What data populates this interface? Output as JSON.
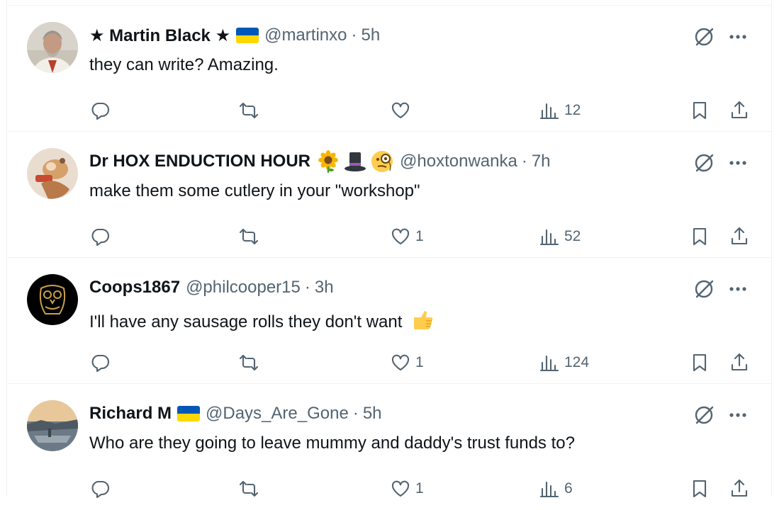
{
  "tweets": [
    {
      "name": "★ Martin Black ★",
      "badges": [
        "ua-flag"
      ],
      "handle": "@martinxo",
      "time": "5h",
      "text": "they can write? Amazing.",
      "counts": {
        "reply": "",
        "retweet": "",
        "like": "",
        "views": "12"
      },
      "avatar": "avatar-man-photo"
    },
    {
      "name": "Dr HOX ENDUCTION HOUR",
      "badges": [
        "sunflower-emoji",
        "top-hat-emoji",
        "monocle-face-emoji"
      ],
      "handle": "@hoxtonwanka",
      "time": "7h",
      "text": "make them some cutlery in your \"workshop\"",
      "counts": {
        "reply": "",
        "retweet": "",
        "like": "1",
        "views": "52"
      },
      "avatar": "avatar-cartoon-drawing"
    },
    {
      "name": "Coops1867",
      "badges": [],
      "handle": "@philcooper15",
      "time": "3h",
      "text": "I'll have any sausage rolls they don't want",
      "text_emoji": "thumbs-up-emoji",
      "counts": {
        "reply": "",
        "retweet": "",
        "like": "1",
        "views": "124"
      },
      "avatar": "avatar-owl-logo"
    },
    {
      "name": "Richard M",
      "badges": [
        "ua-flag"
      ],
      "handle": "@Days_Are_Gone",
      "time": "5h",
      "text": "Who are they going to leave mummy and daddy's trust funds to?",
      "counts": {
        "reply": "",
        "retweet": "",
        "like": "1",
        "views": "6"
      },
      "avatar": "avatar-river-photo"
    }
  ],
  "separator": "·",
  "colors": {
    "text": "#0f1419",
    "secondary": "#536471",
    "divider": "#eff3f4",
    "flag_blue": "#0057b7",
    "flag_yellow": "#ffd700"
  }
}
